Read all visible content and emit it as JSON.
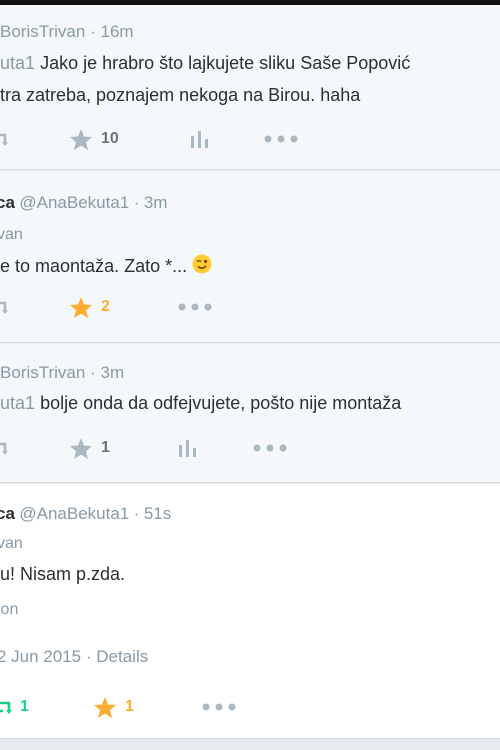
{
  "tweets": [
    {
      "handle": "BorisTrivan",
      "time": "16m",
      "reply_to": "uta1",
      "text_line1": "Jako je hrabro što lajkujete sliku Saše Popović",
      "text_line2": "tra zatreba, poznajem nekoga na Birou. haha",
      "favorites": "10"
    },
    {
      "name": "ca",
      "handle": "@AnaBekuta1",
      "time": "3m",
      "reply_to": "van",
      "text": "e to maontaža. Zato *...",
      "favorites": "2"
    },
    {
      "handle": "BorisTrivan",
      "time": "3m",
      "reply_to": "uta1",
      "text": "bolje onda da odfejvujete, pošto nije montaža",
      "favorites": "1"
    },
    {
      "name": "ca",
      "handle": "@AnaBekuta1",
      "time": "51s",
      "reply_to": "van",
      "text": "u! Nisam p.zda.",
      "source": "ion",
      "date": "2 Jun 2015",
      "details": "Details",
      "retweets": "1",
      "favorites": "1"
    }
  ],
  "separator": "·",
  "colors": {
    "favorite_active": "#ffac33",
    "retweet_active": "#19cf86",
    "muted": "#8899a6",
    "icon_grey": "#aab8c2"
  }
}
